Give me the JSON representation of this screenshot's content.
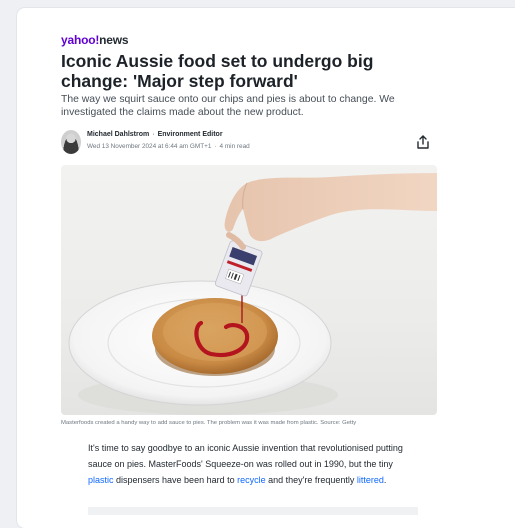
{
  "brand": {
    "logo_prefix": "yahoo!",
    "logo_suffix": "news"
  },
  "article": {
    "headline": "Iconic Aussie food set to undergo big change: 'Major step forward'",
    "subhead": "The way we squirt sauce onto our chips and pies is about to change. We investigated the claims made about the new product.",
    "author_name": "Michael Dahlstrom",
    "author_role": "Environment Editor",
    "date": "Wed 13 November 2024 at 6:44 am GMT+1",
    "read_time": "4 min read",
    "caption": "Masterfoods created a handy way to add sauce to pies. The problem was it was made from plastic. Source: Getty",
    "body_part1": "It's time to say goodbye to an iconic Aussie invention that revolutionised putting sauce on pies. MasterFoods' Squeeze-on was rolled out in 1990, but the tiny ",
    "link_plastic": "plastic",
    "body_part2": " dispensers have been hard to ",
    "link_recycle": "recycle",
    "body_part3": " and they're frequently ",
    "link_littered": "littered",
    "body_part4": "."
  },
  "icons": {
    "share": "share-icon",
    "avatar": "author-avatar"
  },
  "colors": {
    "brand_purple": "#6001d2",
    "link_blue": "#0f69ff",
    "headline": "#1d2228"
  }
}
